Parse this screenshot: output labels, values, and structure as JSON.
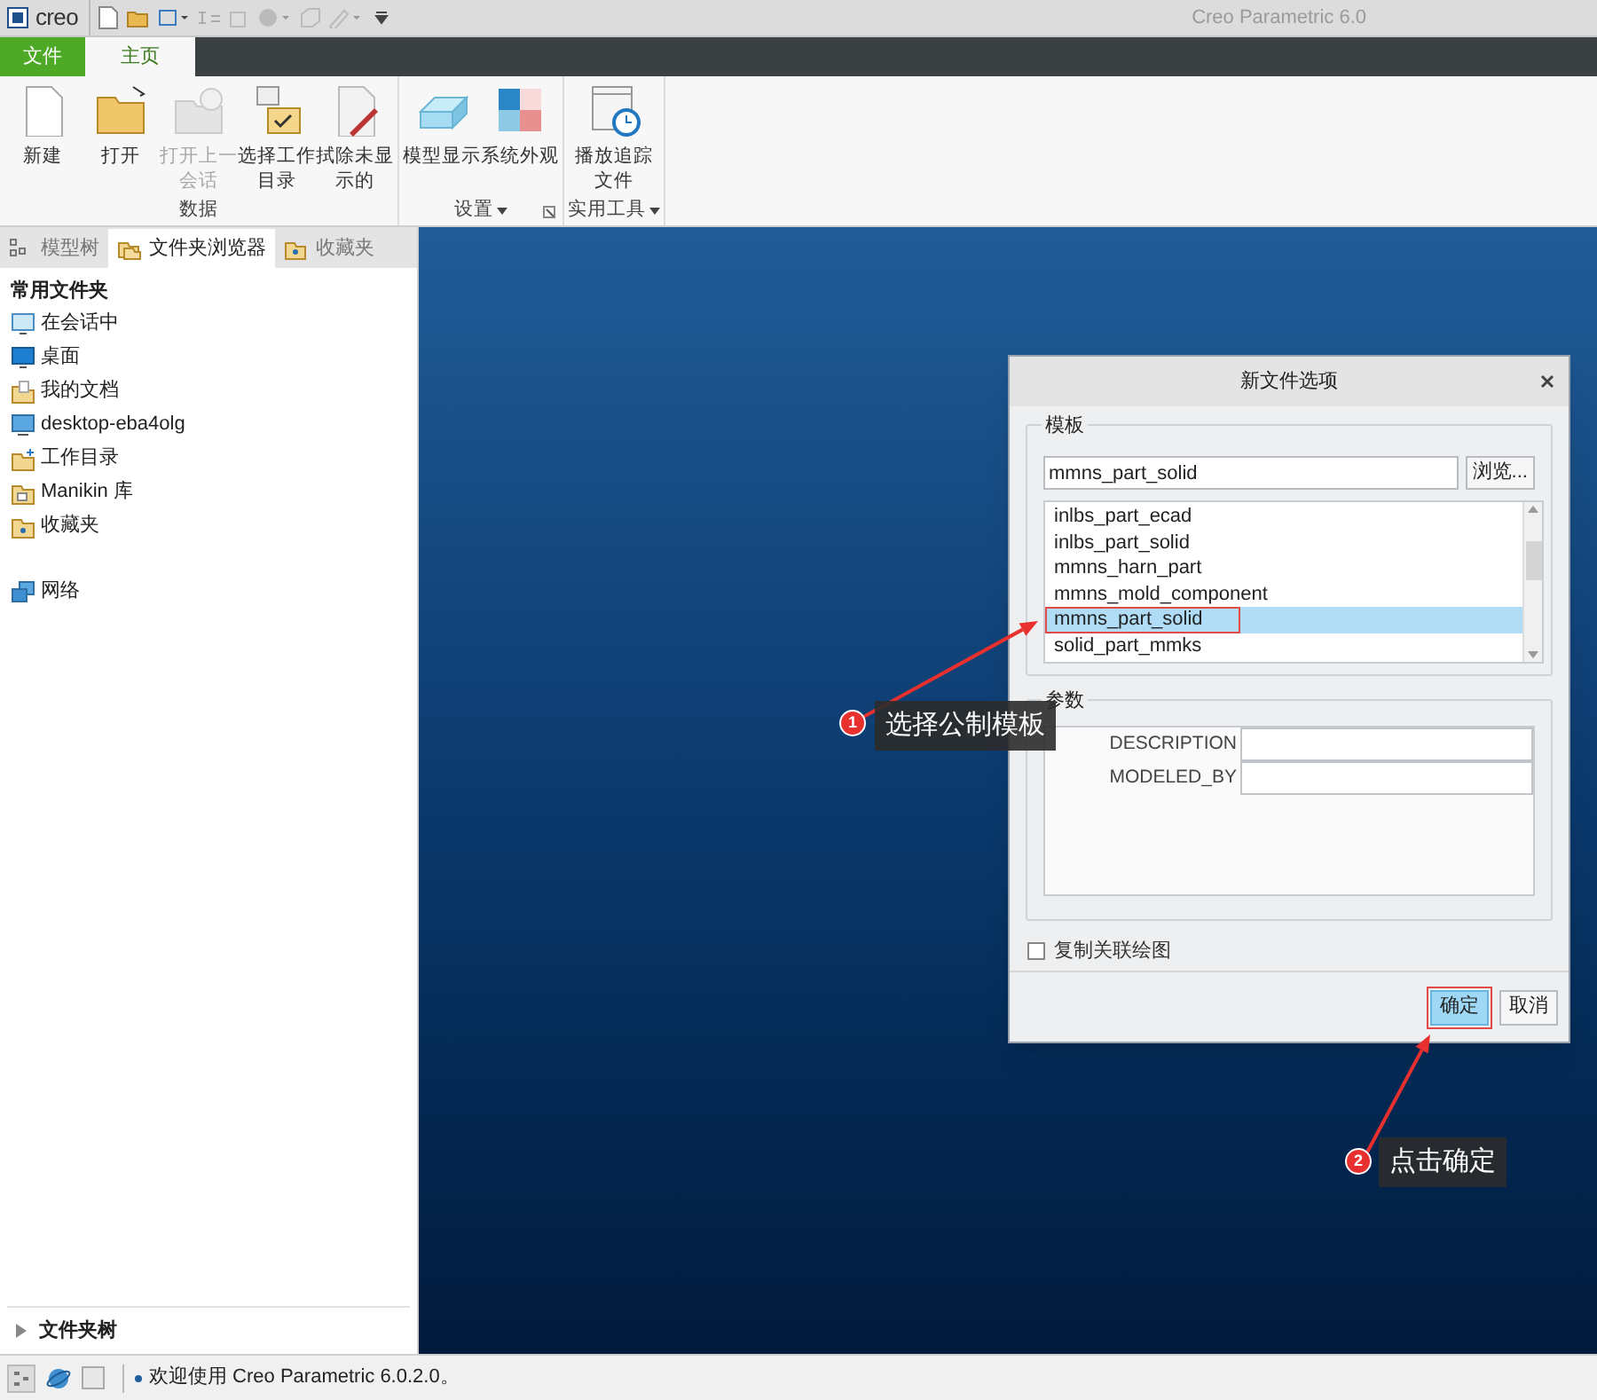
{
  "window": {
    "logo": "creo",
    "title": "Creo Parametric 6.0"
  },
  "ribbon_tabs": [
    {
      "label": "文件",
      "kind": "file",
      "selected": false
    },
    {
      "label": "主页",
      "kind": "tab",
      "selected": true
    }
  ],
  "ribbon_groups": [
    {
      "label": "数据",
      "dropdown": false,
      "launcher": false,
      "buttons": [
        {
          "label": "新建",
          "disabled": false
        },
        {
          "label": "打开",
          "disabled": false
        },
        {
          "label": "打开上一会话",
          "disabled": true
        },
        {
          "label": "选择工作目录",
          "disabled": false
        },
        {
          "label": "拭除未显示的",
          "disabled": false
        }
      ]
    },
    {
      "label": "设置",
      "dropdown": true,
      "launcher": true,
      "buttons": [
        {
          "label": "模型显示",
          "disabled": false
        },
        {
          "label": "系统外观",
          "disabled": false
        }
      ]
    },
    {
      "label": "实用工具",
      "dropdown": true,
      "launcher": false,
      "buttons": [
        {
          "label": "播放追踪文件",
          "disabled": false
        }
      ]
    }
  ],
  "panel_tabs": [
    {
      "label": "模型树",
      "selected": false
    },
    {
      "label": "文件夹浏览器",
      "selected": true
    },
    {
      "label": "收藏夹",
      "selected": false
    }
  ],
  "folders": {
    "heading": "常用文件夹",
    "items": [
      {
        "label": "在会话中"
      },
      {
        "label": "桌面"
      },
      {
        "label": "我的文档"
      },
      {
        "label": "desktop-eba4olg"
      },
      {
        "label": "工作目录"
      },
      {
        "label": "Manikin 库"
      },
      {
        "label": "收藏夹"
      }
    ],
    "network": {
      "label": "网络"
    }
  },
  "folder_tree": {
    "label": "文件夹树",
    "expanded": false
  },
  "status_bar": {
    "message": "欢迎使用 Creo Parametric 6.0.2.0。"
  },
  "dialog": {
    "title": "新文件选项",
    "template_group": "模板",
    "template_value": "mmns_part_solid",
    "browse_button": "浏览...",
    "templates": [
      {
        "label": "inlbs_part_ecad",
        "selected": false
      },
      {
        "label": "inlbs_part_solid",
        "selected": false
      },
      {
        "label": "mmns_harn_part",
        "selected": false
      },
      {
        "label": "mmns_mold_component",
        "selected": false
      },
      {
        "label": "mmns_part_solid",
        "selected": true
      },
      {
        "label": "solid_part_mmks",
        "selected": false
      }
    ],
    "parameter_group": "参数",
    "parameters": [
      {
        "name": "DESCRIPTION"
      },
      {
        "name": "MODELED_BY"
      }
    ],
    "copy_drawing": {
      "label": "复制关联绘图",
      "checked": false
    },
    "buttons": [
      {
        "label": "确定",
        "default": true
      },
      {
        "label": "取消",
        "default": false
      }
    ]
  },
  "annotations": [
    {
      "number": "1",
      "text": "选择公制模板"
    },
    {
      "number": "2",
      "text": "点击确定"
    }
  ]
}
